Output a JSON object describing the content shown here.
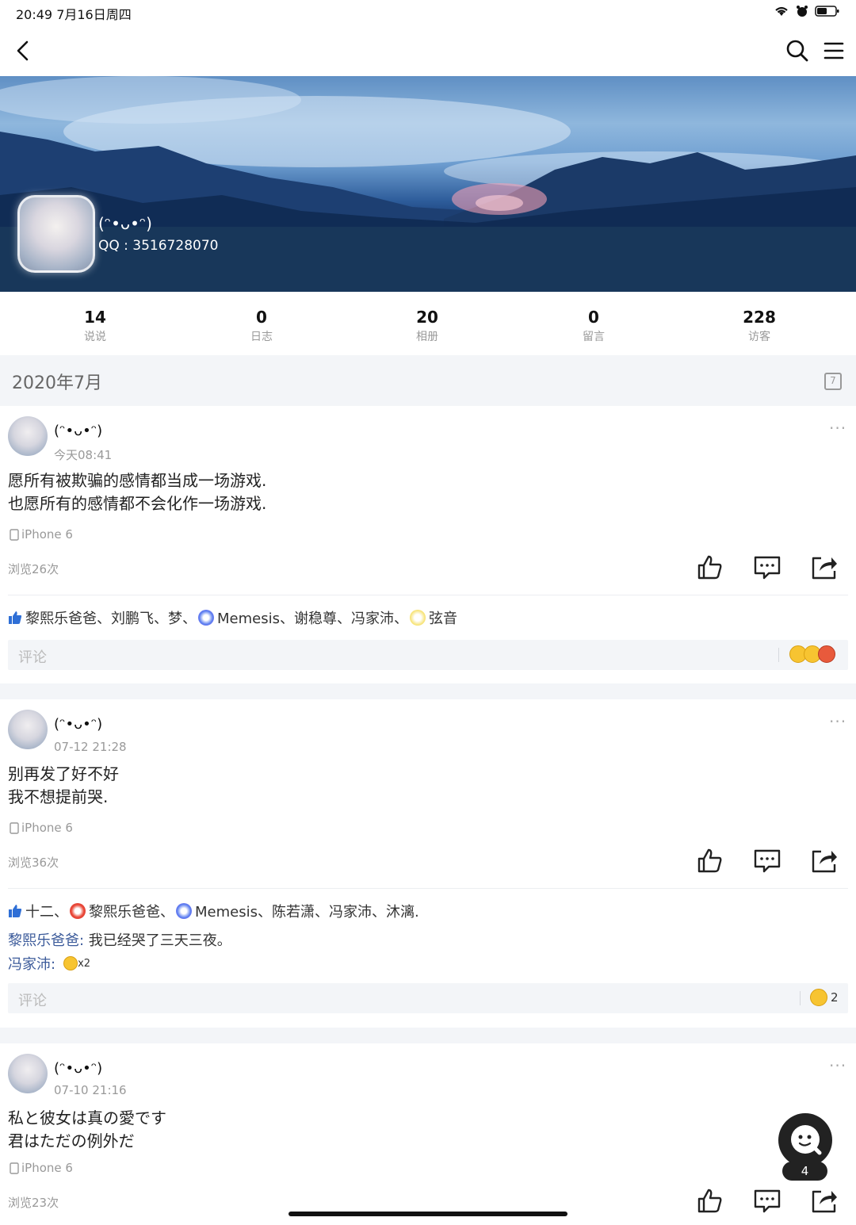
{
  "status_bar": {
    "time_date": "20:49   7月16日周四"
  },
  "profile": {
    "name": "(ᵔ•ᴗ•ᵔ)",
    "qq": "QQ : 3516728070"
  },
  "stats": [
    {
      "value": "14",
      "label": "说说"
    },
    {
      "value": "0",
      "label": "日志"
    },
    {
      "value": "20",
      "label": "相册"
    },
    {
      "value": "0",
      "label": "留言"
    },
    {
      "value": "228",
      "label": "访客"
    }
  ],
  "month": "2020年7月",
  "calendar_day": "7",
  "posts": [
    {
      "author": "(ᵔ•ᴗ•ᵔ)",
      "time": "今天08:41",
      "lines": [
        "愿所有被欺骗的感情都当成一场游戏.",
        "也愿所有的感情都不会化作一场游戏."
      ],
      "device": "iPhone 6",
      "views": "浏览26次",
      "likes": [
        "黎熙乐爸爸、",
        "刘鹏飞、",
        "梦、",
        "Memesis、",
        "谢稳尊、",
        "冯家沛、",
        "弦音"
      ],
      "comment_placeholder": "评论"
    },
    {
      "author": "(ᵔ•ᴗ•ᵔ)",
      "time": "07-12 21:28",
      "lines": [
        "别再发了好不好",
        "我不想提前哭."
      ],
      "device": "iPhone 6",
      "views": "浏览36次",
      "likes": [
        "十二、",
        "黎熙乐爸爸、",
        "Memesis、",
        "陈若潇、",
        "冯家沛、",
        "沐漓."
      ],
      "comments": [
        {
          "author": "黎熙乐爸爸:",
          "text": " 我已经哭了三天三夜。"
        },
        {
          "author": "冯家沛:",
          "text": "x2"
        }
      ],
      "comment_placeholder": "评论",
      "reaction_count": "2"
    },
    {
      "author": "(ᵔ•ᴗ•ᵔ)",
      "time": "07-10 21:16",
      "lines": [
        "私と彼女は真の愛です",
        "君はただの例外だ"
      ],
      "device": "iPhone 6",
      "views": "浏览23次"
    }
  ],
  "fab_badge": "4",
  "icons": {
    "back": "back-arrow-icon",
    "search": "search-icon",
    "menu": "menu-icon",
    "like": "thumbs-up-icon",
    "comment": "comment-icon",
    "share": "share-icon"
  }
}
